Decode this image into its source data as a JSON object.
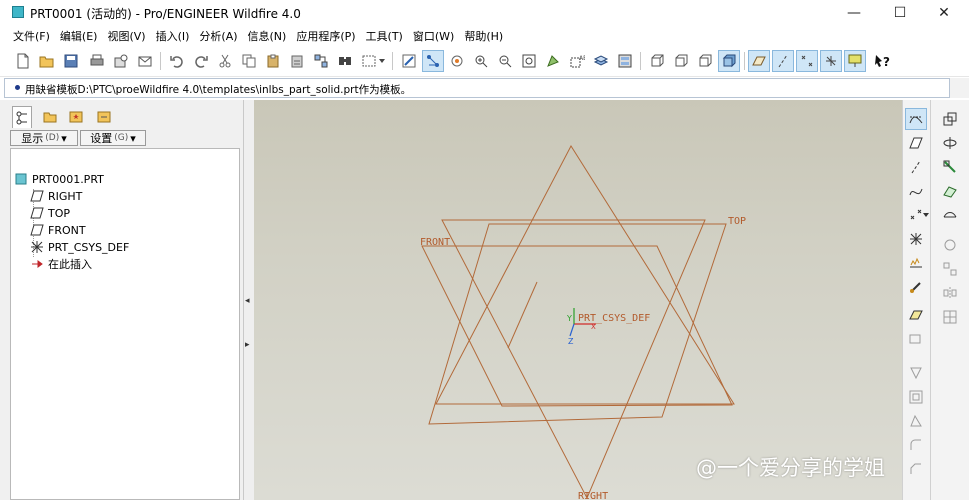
{
  "window": {
    "title": "PRT0001 (活动的) - Pro/ENGINEER Wildfire 4.0",
    "minimize": "—",
    "maximize": "☐",
    "close": "✕"
  },
  "menu": [
    "文件(F)",
    "编辑(E)",
    "视图(V)",
    "插入(I)",
    "分析(A)",
    "信息(N)",
    "应用程序(P)",
    "工具(T)",
    "窗口(W)",
    "帮助(H)"
  ],
  "message": "用缺省模板D:\\PTC\\proeWildfire 4.0\\templates\\inlbs_part_solid.prt作为模板。",
  "panel": {
    "show_label": "显示",
    "show_key": "(D)",
    "settings_label": "设置",
    "settings_key": "(G)",
    "tree": [
      "PRT0001.PRT",
      "RIGHT",
      "TOP",
      "FRONT",
      "PRT_CSYS_DEF",
      "在此插入"
    ]
  },
  "graphics": {
    "labels": {
      "front": "FRONT",
      "top": "TOP",
      "right": "RIGHT",
      "csys": "PRT_CSYS_DEF",
      "axis_y": "Y",
      "axis_z": "Z",
      "axis_x": "X"
    },
    "colors": {
      "datum": "#b26a3a",
      "background": "#d2d1c5"
    }
  },
  "watermark": "@一个爱分享的学姐",
  "icons": {
    "toolbar": [
      "new-file-icon",
      "open-folder-icon",
      "save-icon",
      "print-icon",
      "save-copy-icon",
      "email-icon",
      "undo-icon",
      "redo-icon",
      "cut-icon",
      "copy-icon",
      "paste-icon",
      "paste-special-icon",
      "regenerate-icon",
      "find-icon",
      "select-box-icon",
      "repaint-icon",
      "spin-center-icon",
      "orient-icon",
      "zoom-in-icon",
      "zoom-out-icon",
      "refit-icon",
      "reorient-icon",
      "saved-views-icon",
      "layers-icon",
      "view-manager-icon",
      "wireframe-icon",
      "hidden-line-icon",
      "no-hidden-icon",
      "shading-icon",
      "datum-planes-icon",
      "datum-axes-icon",
      "datum-points-icon",
      "csys-icon",
      "context-help-icon"
    ]
  }
}
